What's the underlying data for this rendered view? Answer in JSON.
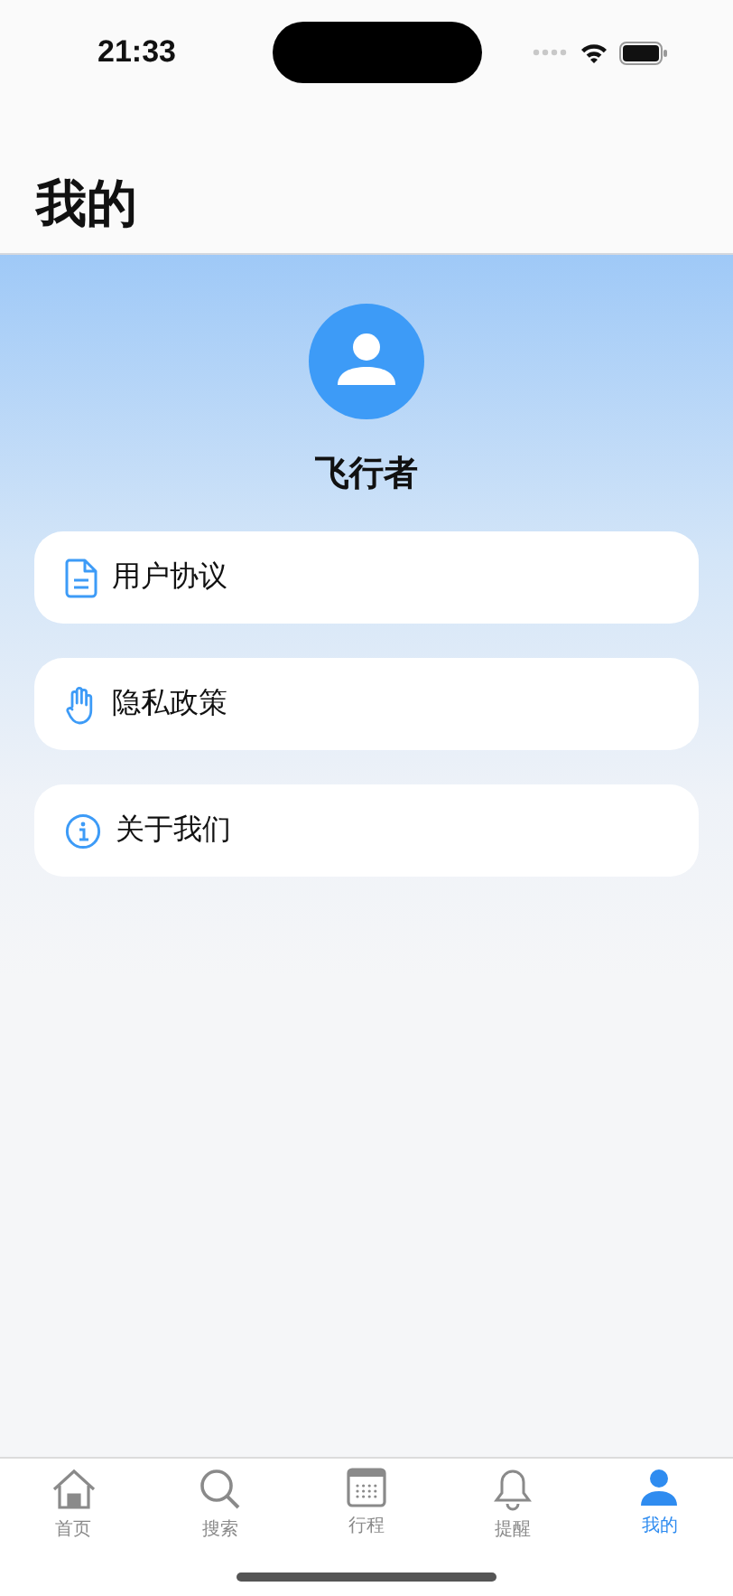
{
  "status_bar": {
    "time": "21:33"
  },
  "header": {
    "title": "我的"
  },
  "profile": {
    "name": "飞行者"
  },
  "menu": [
    {
      "kind": "document",
      "label": "用户协议"
    },
    {
      "kind": "hand",
      "label": "隐私政策"
    },
    {
      "kind": "info",
      "label": "关于我们"
    }
  ],
  "tab_bar": [
    {
      "kind": "home",
      "label": "首页",
      "selected": false
    },
    {
      "kind": "search",
      "label": "搜索",
      "selected": false
    },
    {
      "kind": "calendar",
      "label": "行程",
      "selected": false
    },
    {
      "kind": "bell",
      "label": "提醒",
      "selected": false
    },
    {
      "kind": "person",
      "label": "我的",
      "selected": true
    }
  ]
}
